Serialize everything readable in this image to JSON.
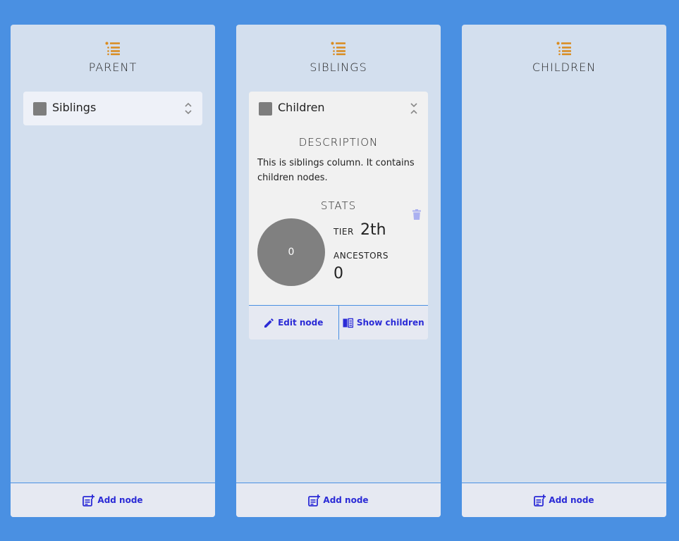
{
  "colors": {
    "background": "#4a90e2",
    "column_bg": "#d3dfee",
    "icon_accent": "#d98b1f",
    "action_text": "#2b2bd6",
    "swatch": "#7d7d7d"
  },
  "columns": [
    {
      "title": "PARENT",
      "icon": "list-icon",
      "nodes": [
        {
          "label": "Siblings"
        }
      ],
      "footer": {
        "label": "Add node",
        "icon": "add-note-icon"
      }
    },
    {
      "title": "SIBLINGS",
      "icon": "list-icon",
      "nodes": [
        {
          "label": "Children",
          "description_title": "DESCRIPTION",
          "description": "This is siblings column. It contains children nodes.",
          "stats_title": "STATS",
          "circle_value": "0",
          "tier_label": "TIER",
          "tier_value": "2th",
          "ancestors_label": "ANCESTORS",
          "ancestors_value": "0",
          "edit_label": "Edit node",
          "show_children_label": "Show children"
        }
      ],
      "footer": {
        "label": "Add node",
        "icon": "add-note-icon"
      }
    },
    {
      "title": "CHILDREN",
      "icon": "list-icon",
      "nodes": [],
      "footer": {
        "label": "Add node",
        "icon": "add-note-icon"
      }
    }
  ]
}
